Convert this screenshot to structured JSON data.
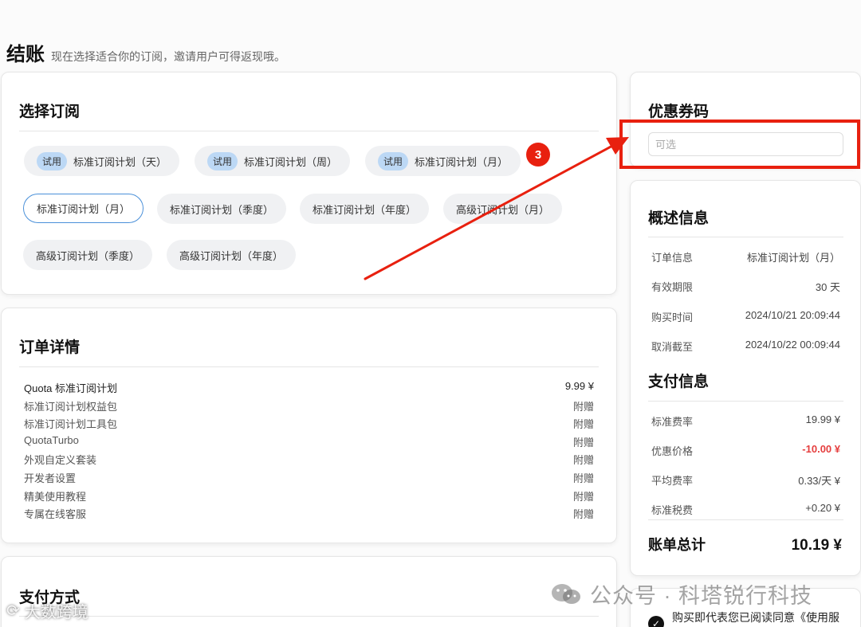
{
  "header": {
    "title": "结账",
    "subtitle": "现在选择适合你的订阅，邀请用户可得返现哦。"
  },
  "plans": {
    "title": "选择订阅",
    "trial_tag": "试用",
    "trial_items": [
      "标准订阅计划（天）",
      "标准订阅计划（周）",
      "标准订阅计划（月）"
    ],
    "items": [
      "标准订阅计划（月）",
      "标准订阅计划（季度）",
      "标准订阅计划（年度）",
      "高级订阅计划（月）",
      "高级订阅计划（季度）",
      "高级订阅计划（年度）"
    ],
    "selected": "标准订阅计划（月）"
  },
  "annotation": {
    "step_number": "3",
    "highlight_color": "#e8200f"
  },
  "order": {
    "title": "订单详情",
    "rows": [
      {
        "name": "Quota 标准订阅计划",
        "value": "9.99 ¥"
      },
      {
        "name": "标准订阅计划权益包",
        "value": "附赠"
      },
      {
        "name": "标准订阅计划工具包",
        "value": "附赠"
      },
      {
        "name": "QuotaTurbo",
        "value": "附赠"
      },
      {
        "name": "外观自定义套装",
        "value": "附赠"
      },
      {
        "name": "开发者设置",
        "value": "附赠"
      },
      {
        "name": "精美使用教程",
        "value": "附赠"
      },
      {
        "name": "专属在线客服",
        "value": "附赠"
      }
    ]
  },
  "payment_method": {
    "title": "支付方式"
  },
  "coupon": {
    "title": "优惠券码",
    "placeholder": "可选"
  },
  "summary": {
    "title": "概述信息",
    "rows": [
      {
        "label": "订单信息",
        "value": "标准订阅计划（月）"
      },
      {
        "label": "有效期限",
        "value": "30 天"
      },
      {
        "label": "购买时间",
        "value": "2024/10/21 20:09:44"
      },
      {
        "label": "取消截至",
        "value": "2024/10/22 00:09:44"
      }
    ]
  },
  "payment": {
    "title": "支付信息",
    "rows": [
      {
        "label": "标准费率",
        "value": "19.99 ¥"
      },
      {
        "label": "优惠价格",
        "value": "-10.00 ¥",
        "highlight": true
      },
      {
        "label": "平均费率",
        "value": "0.33/天 ¥"
      },
      {
        "label": "标准税费",
        "value": "+0.20 ¥"
      }
    ],
    "total_label": "账单总计",
    "total_value": "10.19 ¥",
    "discount_color": "#e53e3e"
  },
  "agreement": {
    "text": "购买即代表您已阅读同意《使用服",
    "check_icon": "check-icon"
  },
  "watermarks": {
    "right": "公众号 · 科塔锐行科技",
    "left": "大数跨境"
  }
}
